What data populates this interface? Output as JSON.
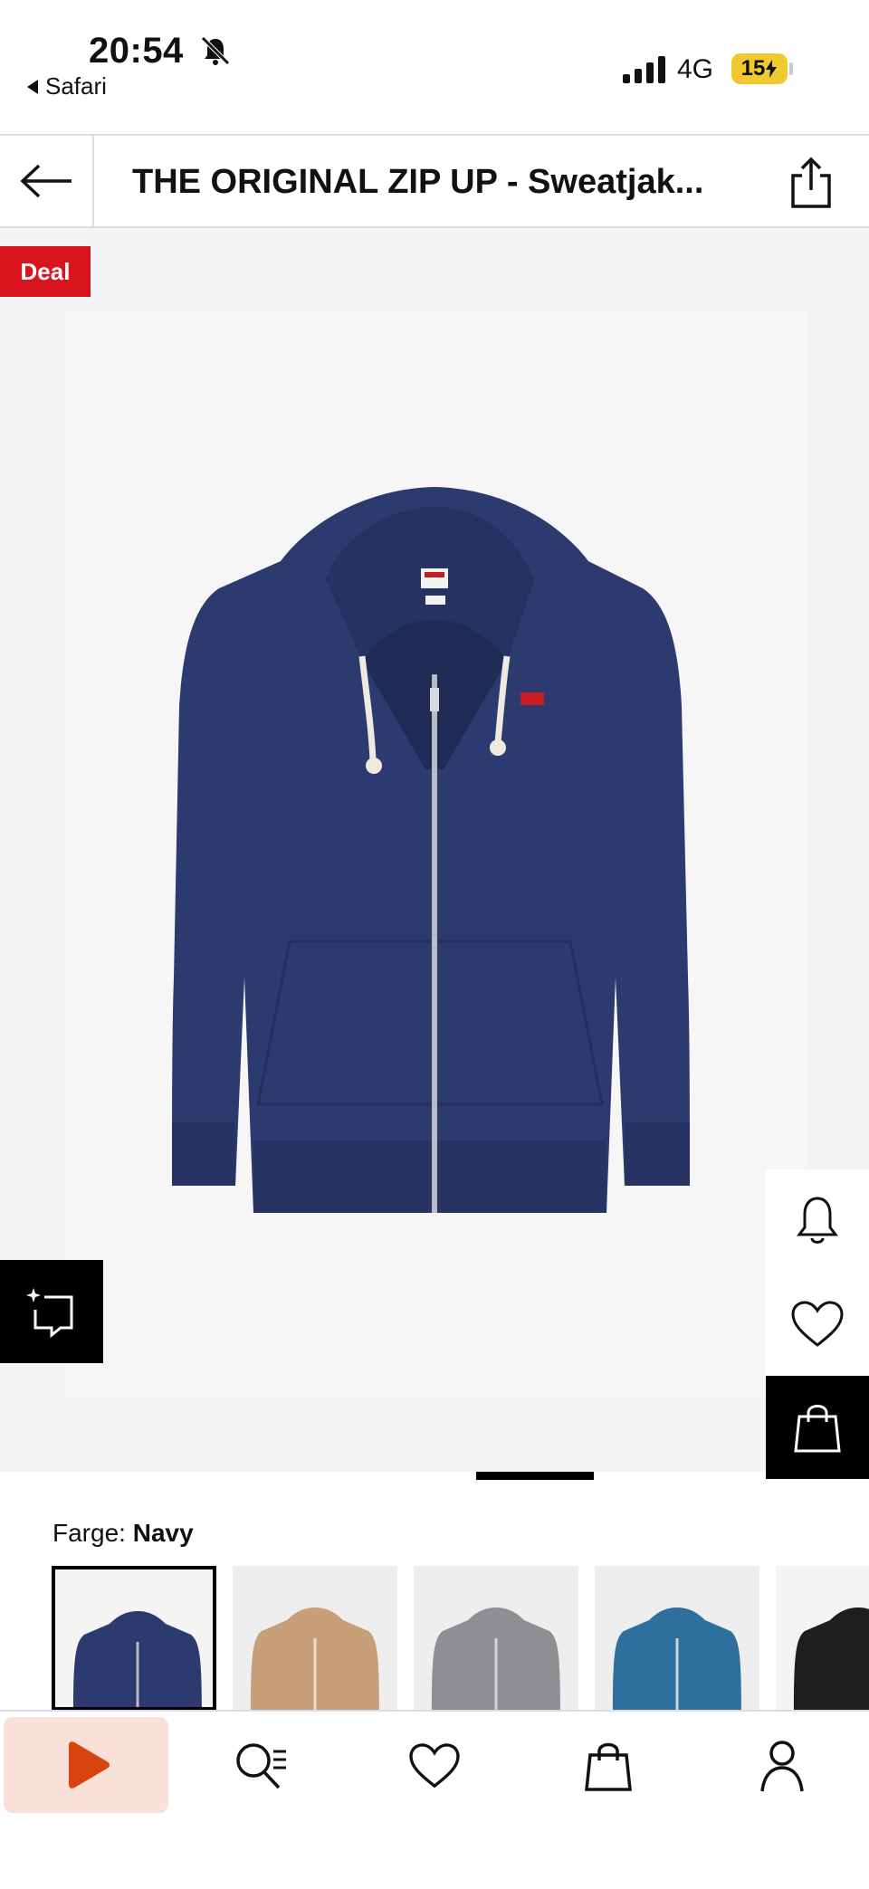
{
  "status_bar": {
    "time": "20:54",
    "back_app": "Safari",
    "network": "4G",
    "battery": "15"
  },
  "nav": {
    "title": "THE ORIGINAL ZIP UP - Sweatjak..."
  },
  "product": {
    "badge": "Deal",
    "image_alt": "Navy zip-up hoodie",
    "color_label": "Farge:",
    "color_value": "Navy",
    "swatches": [
      {
        "name": "Navy",
        "color": "#2d3a70",
        "selected": true
      },
      {
        "name": "Beige",
        "color": "#c7a07a",
        "selected": false
      },
      {
        "name": "Grey",
        "color": "#8e8f92",
        "selected": false
      },
      {
        "name": "Blue",
        "color": "#2f6f9e",
        "selected": false
      },
      {
        "name": "Black",
        "color": "#1e1e1e",
        "selected": false
      }
    ]
  },
  "side_actions": [
    "bell-icon",
    "heart-icon",
    "shopping-bag-icon"
  ],
  "tabs": [
    "play-icon",
    "search-list-icon",
    "heart-icon",
    "shopping-bag-icon",
    "person-icon"
  ],
  "colors": {
    "deal_red": "#d9141e",
    "play_orange": "#d8440f",
    "hoodie_navy": "#2d3a70"
  }
}
